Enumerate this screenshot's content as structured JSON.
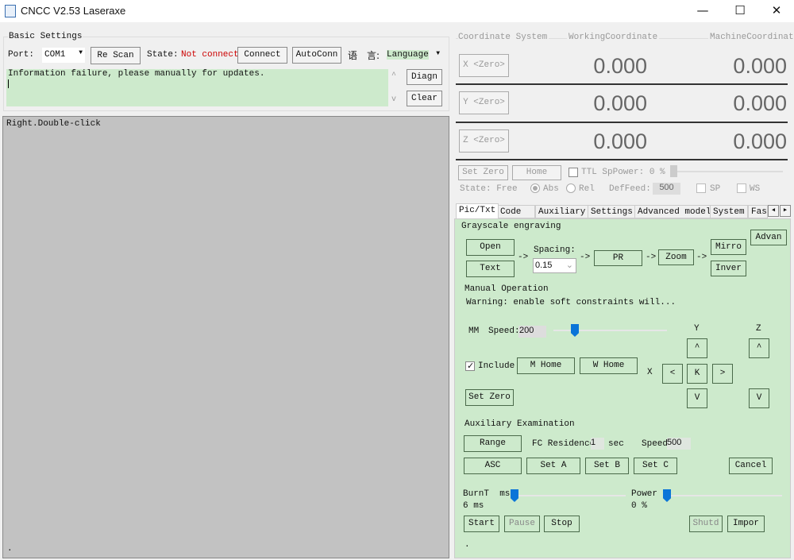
{
  "window": {
    "title": "CNCC V2.53  Laseraxe",
    "controls": [
      "—",
      "☐",
      "✕"
    ]
  },
  "basic": {
    "group_label": "Basic Settings",
    "port_label": "Port:",
    "port_value": "COM1",
    "rescan": "Re Scan",
    "state_label": "State:",
    "state_value": "Not connecte",
    "connect": "Connect",
    "autoconn": "AutoConn",
    "lang_cn1": "语",
    "lang_cn2": "言:",
    "language": "Language",
    "log_text": "Information failure, please manually for updates.",
    "diagn": "Diagn",
    "clear": "Clear",
    "state_color": "#cc0000"
  },
  "canvas": {
    "hint": "Right.Double-click",
    "dot": "."
  },
  "coords": {
    "group_label": "Coordinate System",
    "working_label": "WorkingCoordinate",
    "machine_label": "MachineCoordinate",
    "rows": [
      {
        "zero": "X <Zero>",
        "working": "0.000",
        "machine": "0.000"
      },
      {
        "zero": "Y <Zero>",
        "working": "0.000",
        "machine": "0.000"
      },
      {
        "zero": "Z <Zero>",
        "working": "0.000",
        "machine": "0.000"
      }
    ],
    "set_zero": "Set Zero",
    "home": "Home",
    "ttl_label": "TTL SpPower: 0 %",
    "sp_power_percent": 0,
    "state": "State: Free",
    "abs": "Abs",
    "rel": "Rel",
    "deffeed_label": "DefFeed:",
    "deffeed": "500",
    "sp": "SP",
    "ws": "WS"
  },
  "tabs": [
    {
      "label": "Pic/Txt",
      "active": true
    },
    {
      "label": "Code"
    },
    {
      "label": "Auxiliary"
    },
    {
      "label": "Settings"
    },
    {
      "label": "Advanced model"
    },
    {
      "label": "System"
    },
    {
      "label": "Fas"
    }
  ],
  "pic": {
    "grayscale_label": "Grayscale engraving",
    "open": "Open",
    "text": "Text",
    "spacing_label": "Spacing:",
    "spacing": "0.15",
    "pr": "PR",
    "zoom": "Zoom",
    "mirro": "Mirro",
    "inver": "Inver",
    "advan": "Advan",
    "arrow": "->",
    "manual_label": "Manual Operation",
    "warning": "Warning: enable soft constraints will...",
    "mm": "MM",
    "speed_label": "Speed:",
    "speed": "200",
    "include": "Include",
    "include_checked": true,
    "m_home": "M Home",
    "w_home": "W Home",
    "set_zero": "Set Zero",
    "y": "Y",
    "z": "Z",
    "x": "X",
    "up": "^",
    "down": "V",
    "left": "<",
    "right": ">",
    "k": "K",
    "aux_label": "Auxiliary Examination",
    "range": "Range",
    "fc_label": "FC Residence",
    "fc_value": "1",
    "sec": "sec",
    "speed2_label": "Speed",
    "speed2": "500",
    "asc": "ASC",
    "set_a": "Set A",
    "set_b": "Set B",
    "set_c": "Set C",
    "cancel": "Cancel",
    "burnt_label": "BurnT  ms",
    "burnt_value": "6 ms",
    "power_label": "Power",
    "power_value": "0 %",
    "start": "Start",
    "pause": "Pause",
    "stop": "Stop",
    "shutd": "Shutd",
    "impor": "Impor",
    "dot": "."
  }
}
